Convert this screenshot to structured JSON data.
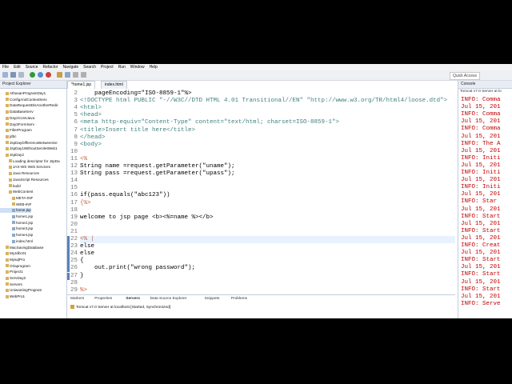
{
  "menu": [
    "File",
    "Edit",
    "Source",
    "Refactor",
    "Navigate",
    "Search",
    "Project",
    "Run",
    "Window",
    "Help"
  ],
  "toolbar": {
    "quick_access": "Quick Access"
  },
  "project_explorer": {
    "title": "Project Explorer",
    "items": [
      "AthaxanProgramDay1",
      "ConfigAndContextServ",
      "DataRequestDisAnotherRedir",
      "DataBaseServ",
      "Day2ConsJava",
      "Day3FormServ",
      "FilterProgram",
      "jdbc",
      "JspDayDifferenceBetweenSe",
      "JspDay1WithoutServletWeb1",
      "JspDay2",
      "Loading descriptor for JspDa",
      "JAX-WS Web Services",
      "Java Resources",
      "JavaScript Resources",
      "build",
      "WebContent",
      "META-INF",
      "WEB-INF",
      "home.jsp",
      "home1.jsp",
      "home2.jsp",
      "home3.jsp",
      "home4.jsp",
      "index.html",
      "MacSavingDatabase",
      "MyJdbc01",
      "MysqlPro",
      "Oriaprogram",
      "Project1",
      "ServDay2",
      "Servers",
      "UniwantingProgram",
      "WebPro1"
    ]
  },
  "editor": {
    "tabs": [
      "*home1.jsp",
      "index.html"
    ],
    "lines": [
      {
        "n": "2",
        "t": "    pageEncoding=\"ISO-8859-1\"%>"
      },
      {
        "n": "3",
        "t": "<!DOCTYPE html PUBLIC \"-//W3C//DTD HTML 4.01 Transitional//EN\" \"http://www.w3.org/TR/html4/loose.dtd\">"
      },
      {
        "n": "4",
        "t": "<html>"
      },
      {
        "n": "5",
        "t": "<head>"
      },
      {
        "n": "6",
        "t": "<meta http-equiv=\"Content-Type\" content=\"text/html; charset=ISO-8859-1\">"
      },
      {
        "n": "7",
        "t": "<title>Insert title here</title>"
      },
      {
        "n": "8",
        "t": "</head>"
      },
      {
        "n": "9",
        "t": "<body>"
      },
      {
        "n": "10",
        "t": ""
      },
      {
        "n": "11",
        "t": "<%"
      },
      {
        "n": "12",
        "t": "String name =request.getParameter(\"uname\");"
      },
      {
        "n": "13",
        "t": "String pass =request.getParameter(\"upass\");"
      },
      {
        "n": "14",
        "t": ""
      },
      {
        "n": "15",
        "t": ""
      },
      {
        "n": "16",
        "t": "if(pass.equals(\"abc123\"))"
      },
      {
        "n": "17",
        "t": "{%>"
      },
      {
        "n": "18",
        "t": ""
      },
      {
        "n": "19",
        "t": "welcome to jsp page <b><%=name %></b>"
      },
      {
        "n": "20",
        "t": ""
      },
      {
        "n": "21",
        "t": ""
      },
      {
        "n": "22",
        "t": "<% |"
      },
      {
        "n": "23",
        "t": "else"
      },
      {
        "n": "24",
        "t": "else"
      },
      {
        "n": "25",
        "t": "{"
      },
      {
        "n": "26",
        "t": "    out.print(\"wrong password\");"
      },
      {
        "n": "27",
        "t": "}"
      },
      {
        "n": "28",
        "t": ""
      },
      {
        "n": "29",
        "t": "%>"
      }
    ]
  },
  "console": {
    "title": "Console",
    "header": "Tomcat v7.0 Server at lo",
    "lines": [
      "INFO: Comma",
      "Jul 15, 201",
      "INFO: Comma",
      "Jul 15, 201",
      "INFO: Comma",
      "Jul 15, 201",
      "INFO: The A",
      "Jul 15, 201",
      "INFO: Initi",
      "Jul 15, 201",
      "INFO: Initi",
      "Jul 15, 201",
      "INFO: Initi",
      "Jul 15, 201",
      "INFO: Star",
      "Jul 15, 201",
      "INFO: Start",
      "Jul 15, 201",
      "INFO: Start",
      "Jul 15, 201",
      "INFO: Creat",
      "Jul 15, 201",
      "INFO: Start",
      "Jul 15, 201",
      "INFO: Start",
      "Jul 15, 201",
      "INFO: Start",
      "Jul 15, 201",
      "INFO: Serve"
    ]
  },
  "servers": {
    "tabs": [
      "Markers",
      "Properties",
      "Servers",
      "Data Source Explorer",
      "Snippets",
      "Problems"
    ],
    "entry": "Tomcat v7.0 Server at localhost  [Started, Synchronized]"
  },
  "colors": {
    "gutter_mark": "#5a7fc0",
    "console_text": "#c00000",
    "badge": "#1aa34a"
  }
}
